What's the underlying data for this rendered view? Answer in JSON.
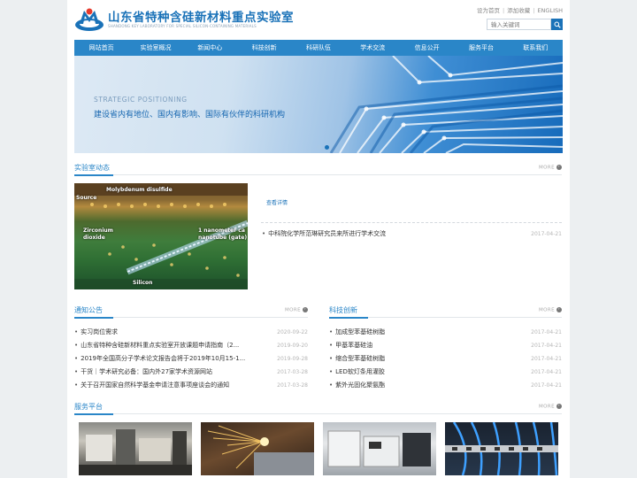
{
  "header": {
    "title": "山东省特种含硅新材料重点实验室",
    "subtitle": "SHANDONG KEY LABORATORY FOR SPECIAL SILICON-CONTAINING MATERIALS",
    "links": [
      "设为首页",
      "添加收藏",
      "ENGLISH"
    ],
    "search_placeholder": "输入关键词"
  },
  "nav": [
    "网站首页",
    "实验室概况",
    "新闻中心",
    "科技创新",
    "科研队伍",
    "学术交流",
    "信息公开",
    "服务平台",
    "联系我们"
  ],
  "banner": {
    "en": "STRATEGIC POSITIONING",
    "cn": "建设省内有地位、国内有影响、国际有伙伴的科研机构"
  },
  "lab_news": {
    "title": "实验室动态",
    "more": "MORE",
    "image_labels": [
      "Molybdenum disulfide",
      "Source",
      "Zirconium",
      "dioxide",
      "1 nanometer ca",
      "nanotube (gate)",
      "Silicon"
    ],
    "detail_link": "查看详情",
    "items": [
      {
        "title": "中科院化学所范琳研究员来所进行学术交流",
        "date": "2017-04-21"
      }
    ]
  },
  "notices": {
    "title": "通知公告",
    "more": "MORE",
    "items": [
      {
        "title": "实习岗位需求",
        "date": "2020-09-22"
      },
      {
        "title": "山东省特种含硅新材料重点实验室开放课题申请指南（2...",
        "date": "2019-09-20"
      },
      {
        "title": "2019年全国高分子学术论文报告会将于2019年10月15-1...",
        "date": "2019-09-28"
      },
      {
        "title": "干货｜学术研究必备：国内外27家学术资源网站",
        "date": "2017-03-28"
      },
      {
        "title": "关于召开国家自然科学基金申请注意事项座谈会的通知",
        "date": "2017-03-28"
      }
    ]
  },
  "innovation": {
    "title": "科技创新",
    "more": "MORE",
    "items": [
      {
        "title": "加成型苯基硅树脂",
        "date": "2017-04-21"
      },
      {
        "title": "甲基苯基硅油",
        "date": "2017-04-21"
      },
      {
        "title": "缩合型苯基硅树脂",
        "date": "2017-04-21"
      },
      {
        "title": "LED软灯条用灌胶",
        "date": "2017-04-21"
      },
      {
        "title": "紫外光固化聚氨酯",
        "date": "2017-04-21"
      }
    ]
  },
  "services": {
    "title": "服务平台",
    "more": "MORE"
  },
  "colors": {
    "brand": "#1a72b8",
    "nav": "#2a86c8"
  }
}
